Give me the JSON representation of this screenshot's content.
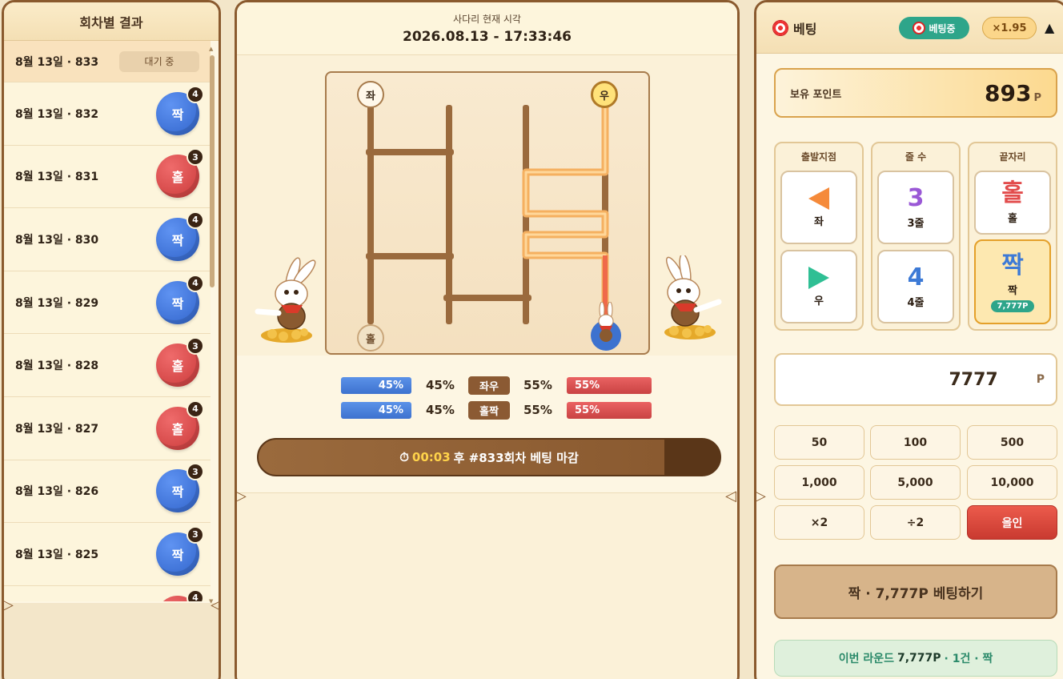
{
  "left": {
    "title": "회차별 결과",
    "rounds": [
      {
        "label": "8월 13일 · 833",
        "status": "대기 중"
      },
      {
        "label": "8월 13일 · 832",
        "result": "짝",
        "count": "4",
        "type": "even"
      },
      {
        "label": "8월 13일 · 831",
        "result": "홀",
        "count": "3",
        "type": "odd"
      },
      {
        "label": "8월 13일 · 830",
        "result": "짝",
        "count": "4",
        "type": "even"
      },
      {
        "label": "8월 13일 · 829",
        "result": "짝",
        "count": "4",
        "type": "even"
      },
      {
        "label": "8월 13일 · 828",
        "result": "홀",
        "count": "3",
        "type": "odd"
      },
      {
        "label": "8월 13일 · 827",
        "result": "홀",
        "count": "4",
        "type": "odd"
      },
      {
        "label": "8월 13일 · 826",
        "result": "짝",
        "count": "3",
        "type": "even"
      },
      {
        "label": "8월 13일 · 825",
        "result": "짝",
        "count": "3",
        "type": "even"
      },
      {
        "label": "",
        "result": "",
        "count": "4",
        "type": "odd"
      }
    ]
  },
  "center": {
    "clock_title": "사다리 현재 시각",
    "clock_time": "2026.08.13 - 17:33:46",
    "ladder": {
      "start_left": "좌",
      "start_right": "우",
      "end_left": "홀"
    },
    "stats": [
      {
        "left_bar": "45%",
        "left_pct": "45%",
        "tag": "좌우",
        "right_pct": "55%",
        "right_bar": "55%"
      },
      {
        "left_bar": "45%",
        "left_pct": "45%",
        "tag": "홀짝",
        "right_pct": "55%",
        "right_bar": "55%"
      }
    ],
    "timer": {
      "time": "00:03",
      "text": "후 #833회차 베팅 마감",
      "icon": "stopwatch-icon"
    }
  },
  "right": {
    "title": "베팅",
    "status": "베팅중",
    "odds": "×1.95",
    "points_label": "보유 포인트",
    "points_value": "893",
    "points_unit": "P",
    "groups": {
      "start": {
        "title": "출발지점",
        "opt1": "좌",
        "opt2": "우"
      },
      "lines": {
        "title": "줄 수",
        "opt1_big": "3",
        "opt1": "3줄",
        "opt2_big": "4",
        "opt2": "4줄"
      },
      "end": {
        "title": "끝자리",
        "opt1_big": "홀",
        "opt1": "홀",
        "opt2_big": "짝",
        "opt2": "짝",
        "opt2_chip": "7,777P"
      }
    },
    "amount": "7777",
    "amount_unit": "P",
    "quick": [
      "50",
      "100",
      "500",
      "1,000",
      "5,000",
      "10,000",
      "×2",
      "÷2",
      "올인"
    ],
    "submit": "짝 · 7,777P 베팅하기",
    "summary": {
      "prefix": "이번 라운드",
      "amount": "7,777P",
      "suffix": "· 1건 · 짝"
    },
    "colors": {
      "accent": "#2ea58a",
      "odd": "#e24c4c",
      "even": "#3d72cf",
      "brand": "#8a5a2e"
    }
  }
}
